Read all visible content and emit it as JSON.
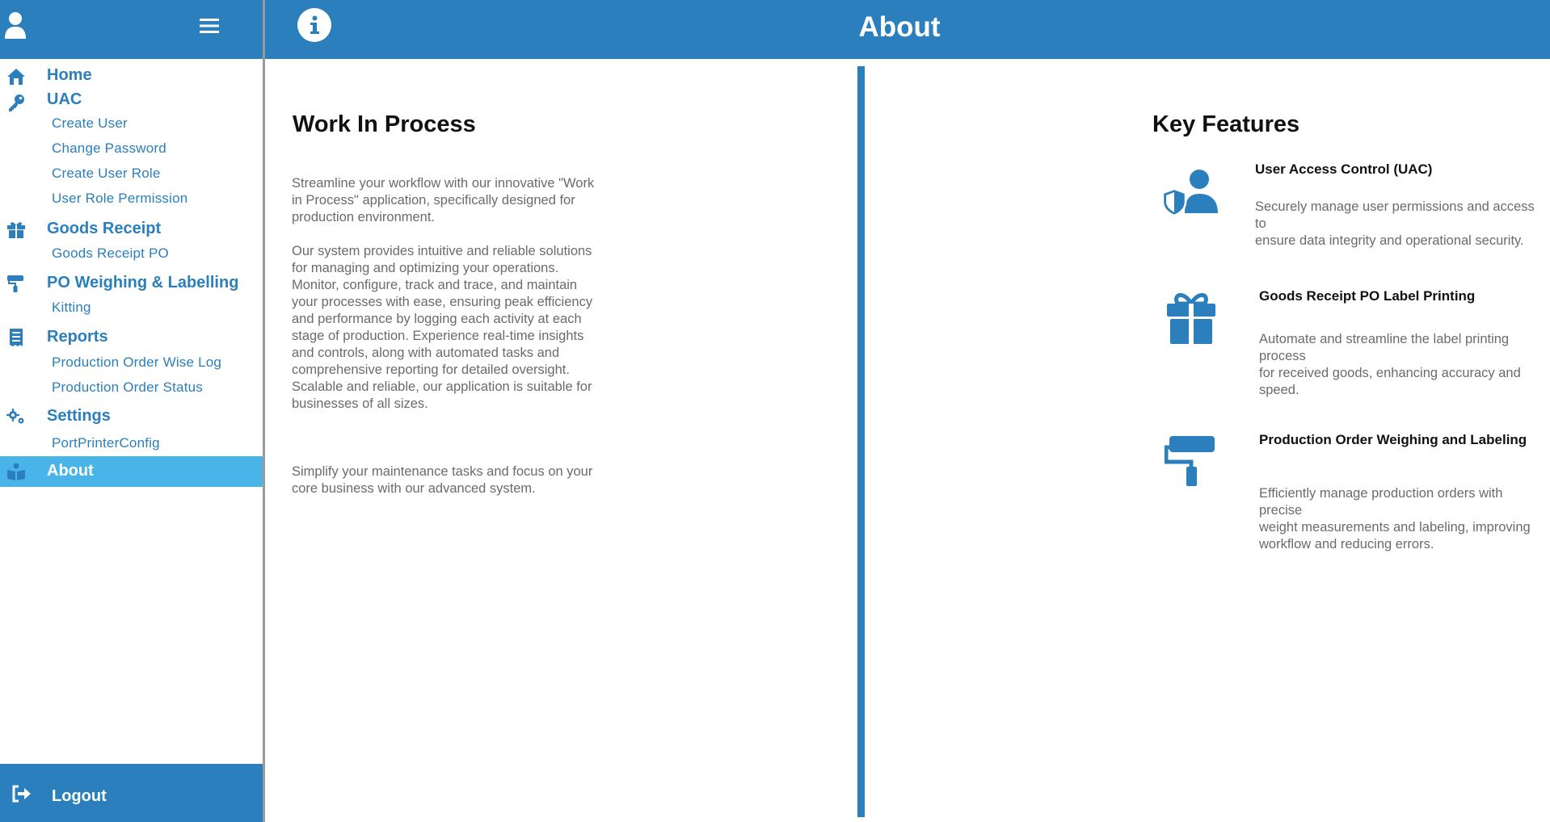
{
  "header": {
    "title": "About"
  },
  "sidebar": {
    "items": [
      {
        "label": "Home",
        "icon": "home-icon"
      },
      {
        "label": "UAC",
        "icon": "key-icon",
        "children": [
          "Create User",
          "Change Password",
          "Create User Role",
          "User Role Permission"
        ]
      },
      {
        "label": "Goods Receipt",
        "icon": "gift-icon",
        "children": [
          "Goods Receipt PO"
        ]
      },
      {
        "label": "PO Weighing & Labelling",
        "icon": "paint-roller-icon",
        "children": [
          "Kitting"
        ]
      },
      {
        "label": "Reports",
        "icon": "receipt-icon",
        "children": [
          "Production Order Wise Log",
          "Production Order Status"
        ]
      },
      {
        "label": "Settings",
        "icon": "gears-icon",
        "children": [
          "PortPrinterConfig"
        ]
      },
      {
        "label": "About",
        "icon": "book-icon",
        "active": true
      }
    ],
    "logout_label": "Logout"
  },
  "left_panel": {
    "title": "Work In Process",
    "paragraphs": [
      "Streamline your workflow with our innovative \"Work in Process\" application, specifically designed for production environment.",
      "Our system provides intuitive and reliable solutions for managing and optimizing your operations. Monitor, configure, track and trace, and maintain your processes with ease, ensuring peak efficiency and performance by logging each activity at each stage of production. Experience real-time insights and controls, along with automated tasks and comprehensive reporting for detailed oversight. Scalable and reliable, our application is suitable for businesses of all sizes.",
      "Simplify your maintenance tasks and focus on your core business with our advanced system."
    ]
  },
  "right_panel": {
    "title": "Key Features",
    "features": [
      {
        "title": "User Access Control (UAC)",
        "icon": "user-shield-icon",
        "description": "Securely manage user permissions and access to\nensure data integrity and operational security."
      },
      {
        "title": "Goods Receipt PO Label Printing",
        "icon": "gift-icon",
        "description": "Automate and streamline the label printing process\nfor received goods, enhancing accuracy and\nspeed."
      },
      {
        "title": "Production Order Weighing and Labeling",
        "icon": "paint-roller-icon",
        "description": "Efficiently manage production orders with precise\nweight measurements and labeling, improving\nworkflow and reducing errors."
      }
    ]
  },
  "colors": {
    "primary": "#2a7fbc",
    "active": "#48b4e7",
    "text_gray": "#6b6b6b"
  }
}
